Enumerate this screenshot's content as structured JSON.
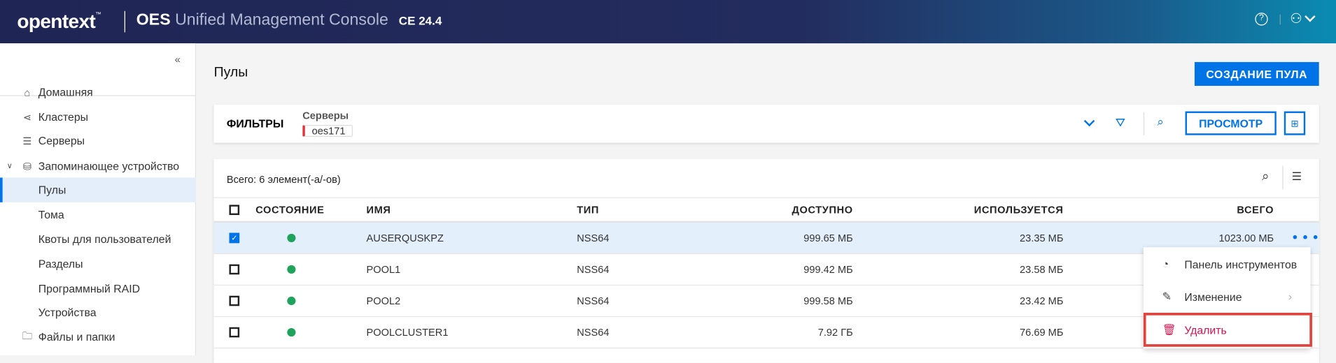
{
  "header": {
    "logo": "opentext",
    "logo_tm": "™",
    "product": "OES",
    "title": "Unified Management Console",
    "version": "CE 24.4"
  },
  "sidebar": {
    "collapse": "«",
    "items": [
      {
        "label": "Домашняя",
        "icon": "home-icon"
      },
      {
        "label": "Кластеры",
        "icon": "share-icon"
      },
      {
        "label": "Серверы",
        "icon": "server-icon"
      },
      {
        "label": "Запоминающее устройство",
        "icon": "database-icon"
      },
      {
        "label": "Пулы"
      },
      {
        "label": "Тома"
      },
      {
        "label": "Квоты для пользователей"
      },
      {
        "label": "Разделы"
      },
      {
        "label": "Программный RAID"
      },
      {
        "label": "Устройства"
      },
      {
        "label": "Файлы и папки",
        "icon": "folder-icon"
      }
    ]
  },
  "page": {
    "title": "Пулы",
    "create_button": "СОЗДАНИЕ ПУЛА"
  },
  "filters": {
    "title": "ФИЛЬТРЫ",
    "servers_label": "Серверы",
    "server_chip": "oes171",
    "view_button": "ПРОСМОТР"
  },
  "table": {
    "total": "Всего: 6 элемент(-а/-ов)",
    "columns": [
      "СОСТОЯНИЕ",
      "ИМЯ",
      "ТИП",
      "ДОСТУПНО",
      "ИСПОЛЬЗУЕТСЯ",
      "ВСЕГО"
    ],
    "rows": [
      {
        "name": "AUSERQUSKPZ",
        "type": "NSS64",
        "available": "999.65 МБ",
        "used": "23.35 МБ",
        "total": "1023.00 МБ",
        "checked": true
      },
      {
        "name": "POOL1",
        "type": "NSS64",
        "available": "999.42 МБ",
        "used": "23.58 МБ",
        "total": ""
      },
      {
        "name": "POOL2",
        "type": "NSS64",
        "available": "999.58 МБ",
        "used": "23.42 МБ",
        "total": ""
      },
      {
        "name": "POOLCLUSTER1",
        "type": "NSS64",
        "available": "7.92 ГБ",
        "used": "76.69 МБ",
        "total": ""
      }
    ],
    "row_menu": "• • •"
  },
  "context_menu": {
    "items": [
      {
        "label": "Панель инструментов"
      },
      {
        "label": "Изменение"
      },
      {
        "label": "Удалить"
      }
    ]
  },
  "colors": {
    "accent": "#0073e7",
    "status_ok": "#1fa35c",
    "delete": "#d4134f",
    "highlight": "#e0433d"
  }
}
